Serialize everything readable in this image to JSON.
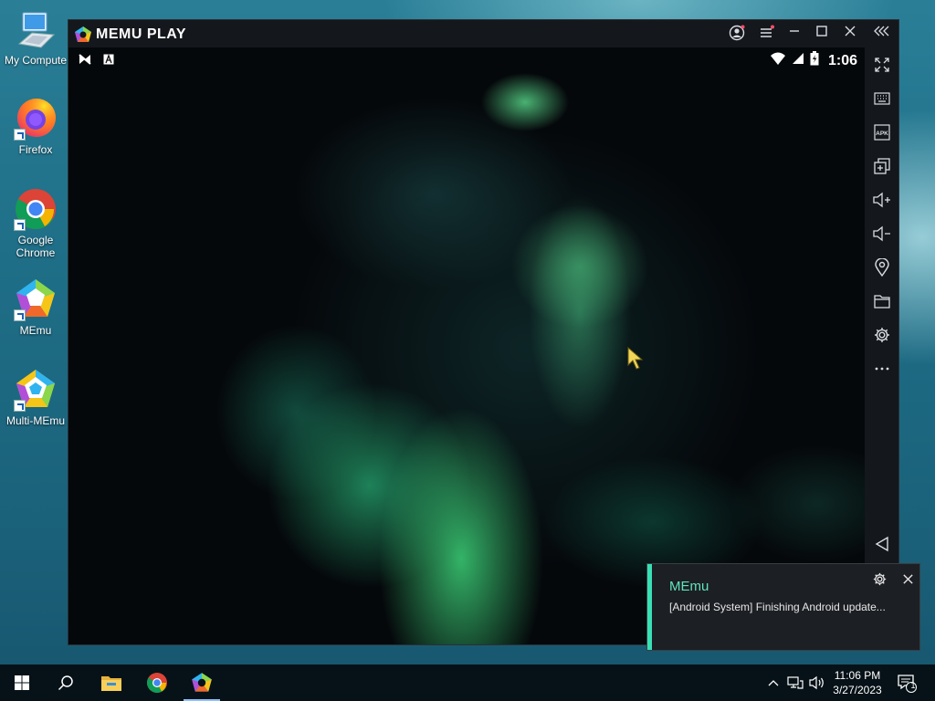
{
  "desktop": {
    "icons": [
      {
        "label": "My Compute",
        "icon": "computer-icon"
      },
      {
        "label": "Firefox",
        "icon": "firefox-icon"
      },
      {
        "label": "Google Chrome",
        "icon": "chrome-icon"
      },
      {
        "label": "MEmu",
        "icon": "memu-icon"
      },
      {
        "label": "Multi-MEmu",
        "icon": "multi-memu-icon"
      }
    ]
  },
  "emulator": {
    "title": "MEMU PLAY",
    "title_buttons": [
      "account-icon",
      "menu-icon",
      "minimize-icon",
      "maximize-icon",
      "close-icon",
      "collapse-sidebar-icon"
    ],
    "status_bar": {
      "left_icons": [
        "n-notification-icon",
        "a-notification-icon"
      ],
      "right_icons": [
        "wifi-icon",
        "signal-icon",
        "battery-icon"
      ],
      "time": "1:06"
    },
    "sidebar_tools": [
      {
        "name": "fullscreen-icon",
        "label": "Full screen"
      },
      {
        "name": "keyboard-icon",
        "label": "Keyboard mapping"
      },
      {
        "name": "apk-icon",
        "label": "APK"
      },
      {
        "name": "multi-window-icon",
        "label": "Multi-window"
      },
      {
        "name": "volume-up-icon",
        "label": "Volume up"
      },
      {
        "name": "volume-down-icon",
        "label": "Volume down"
      },
      {
        "name": "location-icon",
        "label": "Location"
      },
      {
        "name": "folder-icon",
        "label": "Shared folder"
      },
      {
        "name": "settings-icon",
        "label": "Settings"
      },
      {
        "name": "more-icon",
        "label": "More"
      },
      {
        "name": "back-icon",
        "label": "Back"
      }
    ],
    "apk_text": "APK",
    "colors": {
      "chrome": "#14171c",
      "accent": "#38e0b4"
    }
  },
  "notification": {
    "title": "MEmu",
    "message": "[Android System] Finishing Android update..."
  },
  "taskbar": {
    "items": [
      "start-icon",
      "search-icon",
      "file-explorer-icon",
      "chrome-icon",
      "memu-icon"
    ],
    "active_item": "memu-icon",
    "tray_icons": [
      "show-hidden-icons-icon",
      "network-icon",
      "volume-icon"
    ],
    "time": "11:06 PM",
    "date": "3/27/2023",
    "notification_count": "1"
  }
}
